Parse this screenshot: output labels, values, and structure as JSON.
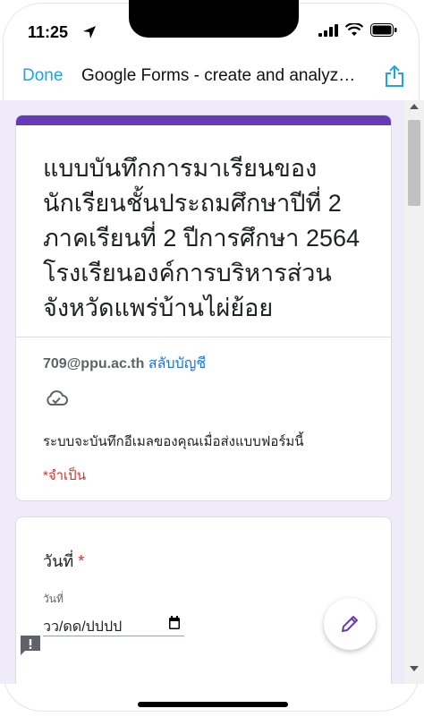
{
  "status_bar": {
    "time": "11:25"
  },
  "nav": {
    "done_label": "Done",
    "title": "Google Forms - create and analyze surveys, for free.",
    "share_icon": "share-icon"
  },
  "header_card": {
    "title": "แบบบันทึกการมาเรียนของนักเรียนชั้นประถมศึกษาปีที่ 2 ภาคเรียนที่ 2 ปีการศึกษา 2564 โรงเรียนองค์การบริหารส่วนจังหวัดแพร่บ้านไผ่ย้อย",
    "account_email": "709@ppu.ac.th",
    "switch_account": "สลับบัญชี",
    "cloud_icon": "cloud-done-icon",
    "email_notice": "ระบบจะบันทึกอีเมลของคุณเมื่อส่งแบบฟอร์มนี้",
    "required_note": "*จำเป็น"
  },
  "question": {
    "title": "วันที่",
    "required_mark": "*",
    "sublabel": "วันที่",
    "date_placeholder": "วว/ดด/ปปปป"
  },
  "colors": {
    "accent": "#673ab7",
    "background": "#f0ebf8",
    "link": "#1a73e8",
    "required": "#d93025",
    "done": "#1aa5e8"
  }
}
